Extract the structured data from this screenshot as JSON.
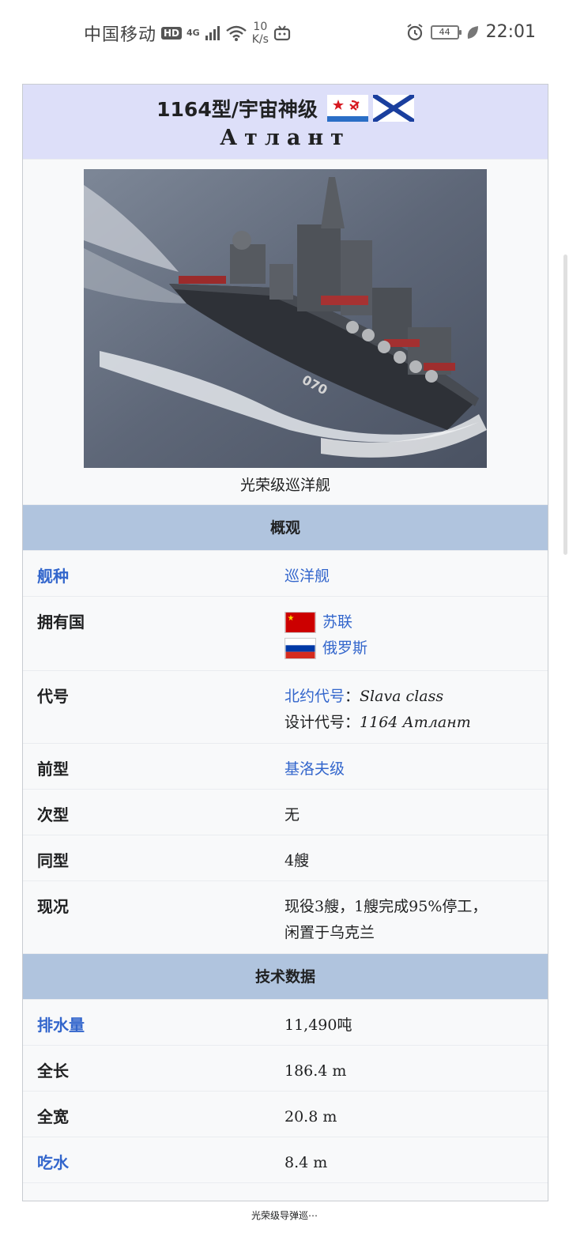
{
  "status_bar": {
    "carrier": "中国移动",
    "hd_badge": "HD",
    "network": "4G",
    "speed_value": "10",
    "speed_unit": "K/s",
    "battery": "44",
    "time": "22:01"
  },
  "infobox": {
    "title": "1164型/宇宙神级",
    "subtitle": "Атлант",
    "image_caption": "光荣级巡洋舰",
    "sections": {
      "overview": "概观",
      "tech": "技术数据"
    },
    "rows": {
      "ship_type": {
        "label": "舰种",
        "value": "巡洋舰"
      },
      "operators": {
        "label": "拥有国",
        "values": [
          "苏联",
          "俄罗斯"
        ]
      },
      "codename": {
        "label": "代号",
        "nato_label": "北约代号",
        "nato_sep": "：",
        "nato_value": "Slava class",
        "design_label": "设计代号：",
        "design_value": "1164 Атлант"
      },
      "preceded": {
        "label": "前型",
        "value": "基洛夫级"
      },
      "succeeded": {
        "label": "次型",
        "value": "无"
      },
      "sister": {
        "label": "同型",
        "value": "4艘"
      },
      "status": {
        "label": "现况",
        "value_line1": "现役3艘，1艘完成95%停工，",
        "value_line2": "闲置于乌克兰"
      },
      "displacement": {
        "label": "排水量",
        "value": "11,490吨"
      },
      "length": {
        "label": "全长",
        "value": "186.4 m"
      },
      "beam": {
        "label": "全宽",
        "value": "20.8 m"
      },
      "draft": {
        "label": "吃水",
        "value": "8.4 m"
      }
    }
  },
  "footer": {
    "text": "光荣级导弹巡⋯"
  },
  "colors": {
    "title_bg": "#dddff9",
    "header_bg": "#b0c4de",
    "link": "#3366cc"
  }
}
